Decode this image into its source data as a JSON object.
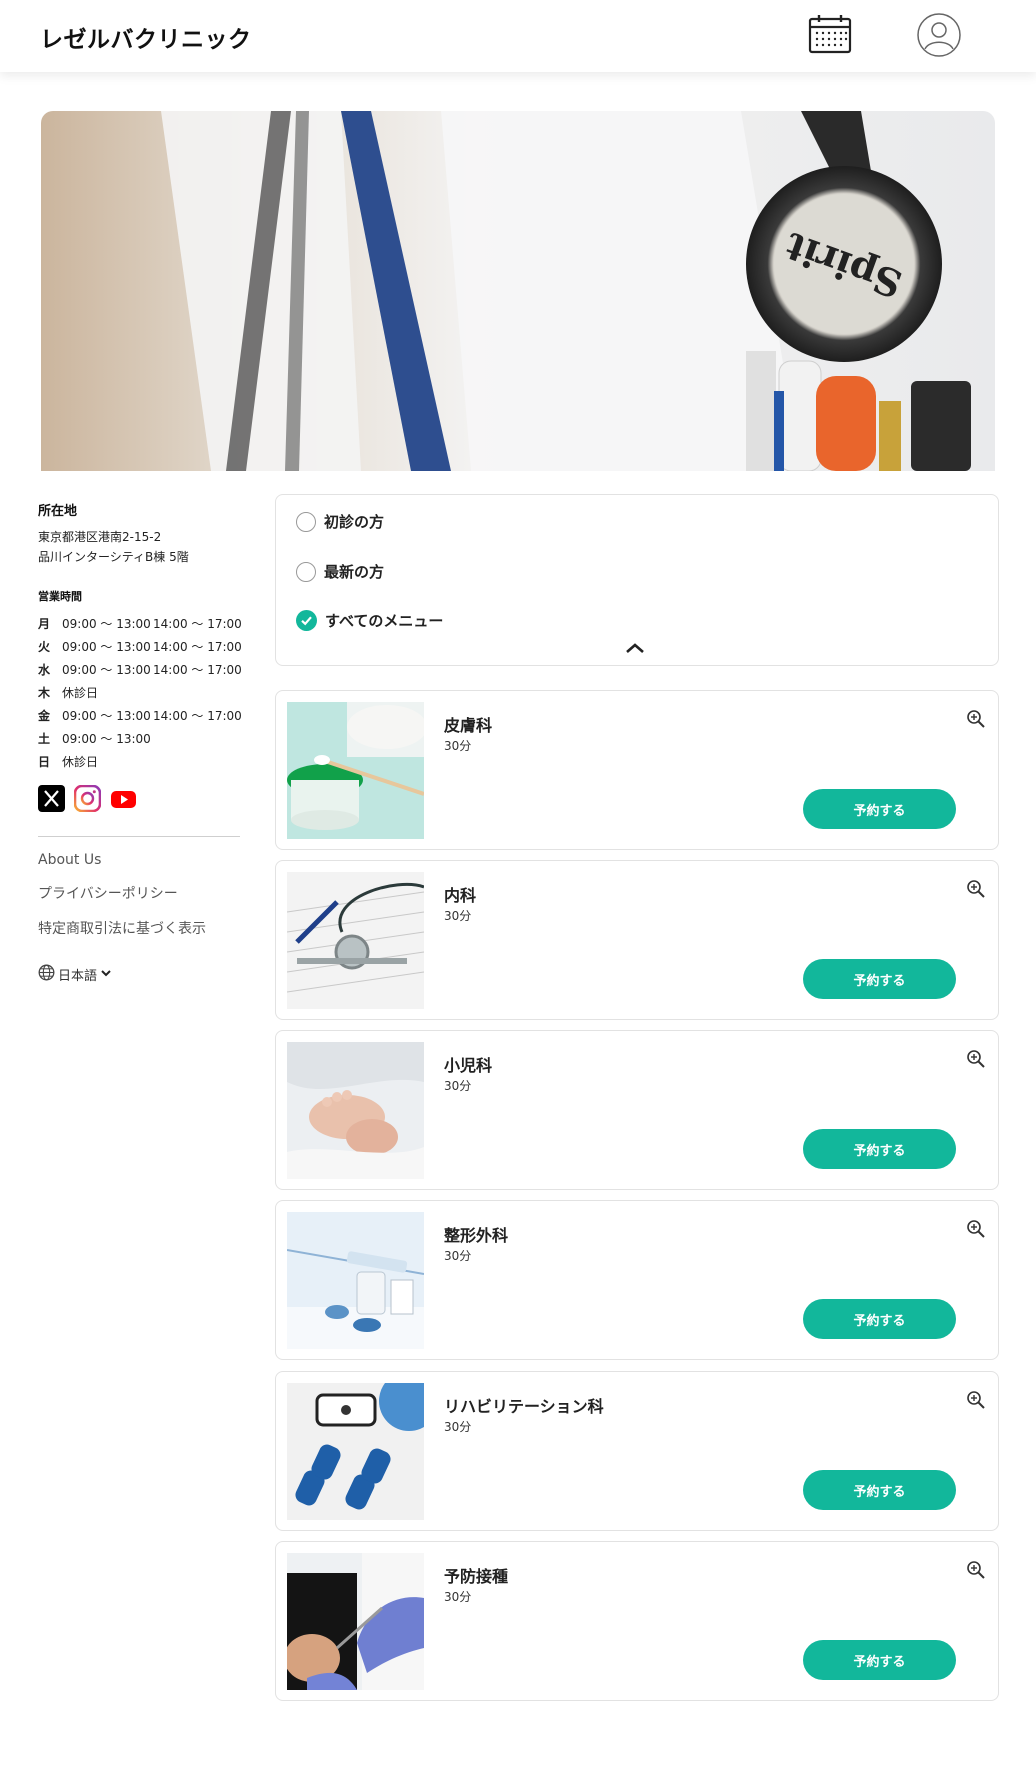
{
  "header": {
    "brand": "レゼルバクリニック"
  },
  "info": {
    "location_title": "所在地",
    "address_line1": "東京都港区港南2-15-2",
    "address_line2": "品川インターシティB棟 5階",
    "hours_title": "営業時間",
    "hours": [
      {
        "day": "月",
        "am": "09:00 〜 13:00",
        "pm": "14:00 〜 17:00"
      },
      {
        "day": "火",
        "am": "09:00 〜 13:00",
        "pm": "14:00 〜 17:00"
      },
      {
        "day": "水",
        "am": "09:00 〜 13:00",
        "pm": "14:00 〜 17:00"
      },
      {
        "day": "木",
        "am": "休診日",
        "pm": ""
      },
      {
        "day": "金",
        "am": "09:00 〜 13:00",
        "pm": "14:00 〜 17:00"
      },
      {
        "day": "土",
        "am": "09:00 〜 13:00",
        "pm": ""
      },
      {
        "day": "日",
        "am": "休診日",
        "pm": ""
      }
    ]
  },
  "footer": {
    "about": "About Us",
    "privacy": "プライバシーポリシー",
    "tokusho": "特定商取引法に基づく表示",
    "language": "日本語"
  },
  "filter": {
    "options": [
      {
        "label": "初診の方",
        "selected": false
      },
      {
        "label": "最新の方",
        "selected": false
      },
      {
        "label": "すべてのメニュー",
        "selected": true
      }
    ]
  },
  "menus": [
    {
      "name": "皮膚科",
      "duration": "30分",
      "button": "予約する"
    },
    {
      "name": "内科",
      "duration": "30分",
      "button": "予約する"
    },
    {
      "name": "小児科",
      "duration": "30分",
      "button": "予約する"
    },
    {
      "name": "整形外科",
      "duration": "30分",
      "button": "予約する"
    },
    {
      "name": "リハビリテーション科",
      "duration": "30分",
      "button": "予約する"
    },
    {
      "name": "予防接種",
      "duration": "30分",
      "button": "予約する"
    }
  ],
  "colors": {
    "accent": "#12b79b",
    "border": "#e2e2e2"
  },
  "icons": [
    "calendar-icon",
    "user-icon",
    "x-icon",
    "instagram-icon",
    "youtube-icon",
    "globe-icon",
    "chevron-down-icon",
    "chevron-up-icon",
    "zoom-in-icon"
  ]
}
